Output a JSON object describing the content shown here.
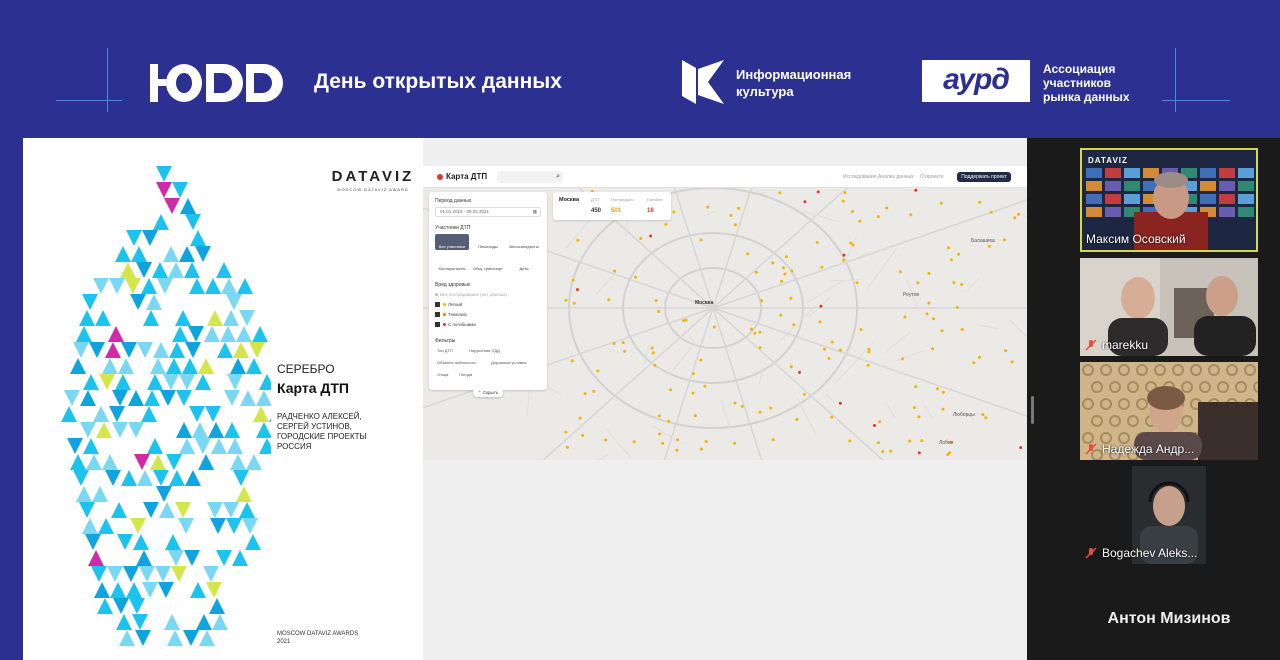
{
  "banner": {
    "logo_text": "ЮDD",
    "title": "День открытых данных",
    "partner1_line1": "Информационная",
    "partner1_line2": "культура",
    "partner2_logo": "аурд",
    "partner2_line1": "Ассоциация",
    "partner2_line2": "участников",
    "partner2_line3": "рынка данных"
  },
  "slide": {
    "brand": "DATAVIZ",
    "brand_sub": "MOSCOW DATAVIZ AWARD",
    "award_level": "СЕРЕБРО",
    "project_title": "Карта ДТП",
    "authors_line1": "РАДЧЕНКО АЛЕКСЕЙ,",
    "authors_line2": "СЕРГЕЙ УСТИНОВ,",
    "authors_line3": "ГОРОДСКИЕ ПРОЕКТЫ",
    "authors_line4": "РОССИЯ",
    "footer_line1": "MOSCOW DATAVIZ AWARDS",
    "footer_line2": "2021"
  },
  "app": {
    "logo": "Карта ДТП",
    "nav": [
      "Исследования",
      "Анализ данных",
      "О проекте"
    ],
    "support_button": "Поддержать проект",
    "filters": {
      "period_label": "Период данных",
      "period_value": "01.01.2015 - 09.03.2021",
      "participants_label": "Участники ДТП",
      "participants": [
        "Все участники",
        "Пешеходы",
        "Велосипедисты",
        "Мотоциклисты",
        "Общ. транспорт",
        "Дети"
      ],
      "severity_label": "Вред здоровью",
      "severity": [
        "Без пострадавших (нет данных)",
        "Легкий",
        "Тяжелый",
        "С погибшими"
      ],
      "more_label": "Фильтры",
      "chips": [
        "Тип ДТП",
        "Нарушения ПДД",
        "Объекты поблизости",
        "Дорожные условия",
        "Улица",
        "Погода"
      ],
      "hide_button": "Скрыть"
    },
    "stats": {
      "city": "Москва",
      "headers": [
        "ДТП",
        "Пострадало",
        "Погибли"
      ],
      "values": [
        "450",
        "501",
        "18"
      ]
    },
    "map_labels": [
      "Москва",
      "Балашиха",
      "Реутов",
      "Люберцы",
      "Лобня"
    ]
  },
  "participants": [
    {
      "name": "Максим Осовский",
      "tag": "DATAVIZ"
    },
    {
      "name": "marekku"
    },
    {
      "name": "Надежда Андр..."
    },
    {
      "name": "Bogachev Aleks..."
    }
  ],
  "last_tile_name": "Антон Мизинов",
  "colors": {
    "banner_bg": "#2b3091",
    "accent_cyan": "#1cc3ee",
    "active_speaker_border": "#d7d74a",
    "crash_yellow": "#f5b400",
    "crash_red": "#e0392b"
  }
}
